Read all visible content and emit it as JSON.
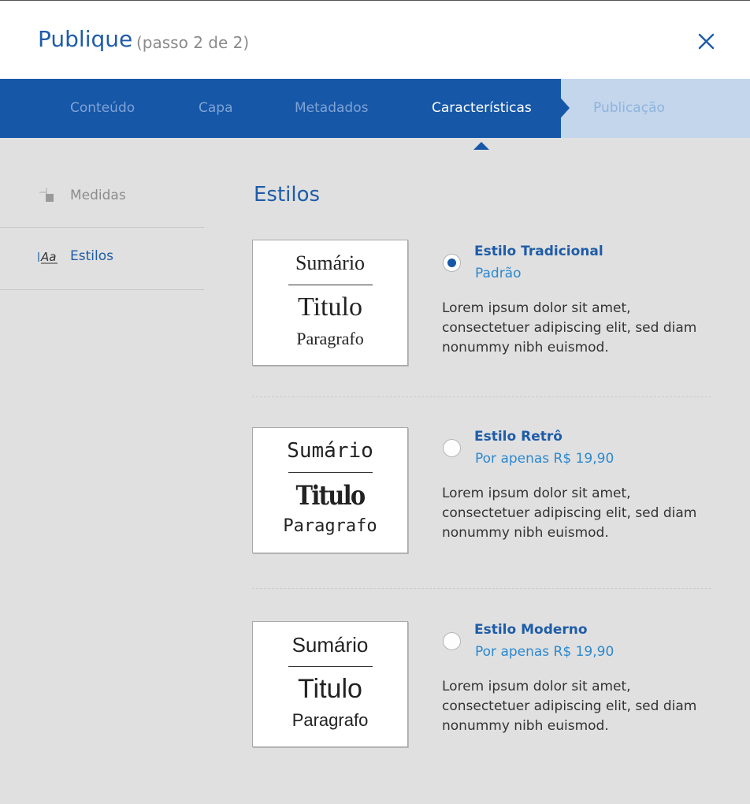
{
  "header": {
    "title": "Publique",
    "subtitle": "(passo 2 de 2)",
    "close_icon": "close-icon"
  },
  "steps": [
    {
      "label": "Conteúdo",
      "state": "done"
    },
    {
      "label": "Capa",
      "state": "done"
    },
    {
      "label": "Metadados",
      "state": "done"
    },
    {
      "label": "Características",
      "state": "active"
    },
    {
      "label": "Publicação",
      "state": "pending"
    }
  ],
  "sidebar": {
    "items": [
      {
        "label": "Medidas",
        "icon": "measure-icon",
        "active": false
      },
      {
        "label": "Estilos",
        "icon": "text-style-icon",
        "active": true
      }
    ]
  },
  "main": {
    "section_title": "Estilos",
    "options": [
      {
        "name": "Estilo Tradicional",
        "price": "Padrão",
        "description": "Lorem ipsum dolor sit amet, consectetuer adipiscing elit, sed diam nonummy nibh euismod.",
        "selected": true,
        "preview": {
          "sumario": "Sumário",
          "titulo": "Titulo",
          "paragrafo": "Paragrafo"
        }
      },
      {
        "name": "Estilo Retrô",
        "price": "Por apenas R$ 19,90",
        "description": "Lorem ipsum dolor sit amet, consectetuer adipiscing elit, sed diam nonummy nibh euismod.",
        "selected": false,
        "preview": {
          "sumario": "Sumário",
          "titulo": "Titulo",
          "paragrafo": "Paragrafo"
        }
      },
      {
        "name": "Estilo Moderno",
        "price": "Por apenas R$ 19,90",
        "description": "Lorem ipsum dolor sit amet, consectetuer adipiscing elit, sed diam nonummy nibh euismod.",
        "selected": false,
        "preview": {
          "sumario": "Sumário",
          "titulo": "Titulo",
          "paragrafo": "Paragrafo"
        }
      }
    ]
  },
  "colors": {
    "brand_blue": "#1657a8",
    "link_blue": "#2c89d0",
    "background": "#e0e0e0",
    "pending_step": "#c3d6ec"
  }
}
